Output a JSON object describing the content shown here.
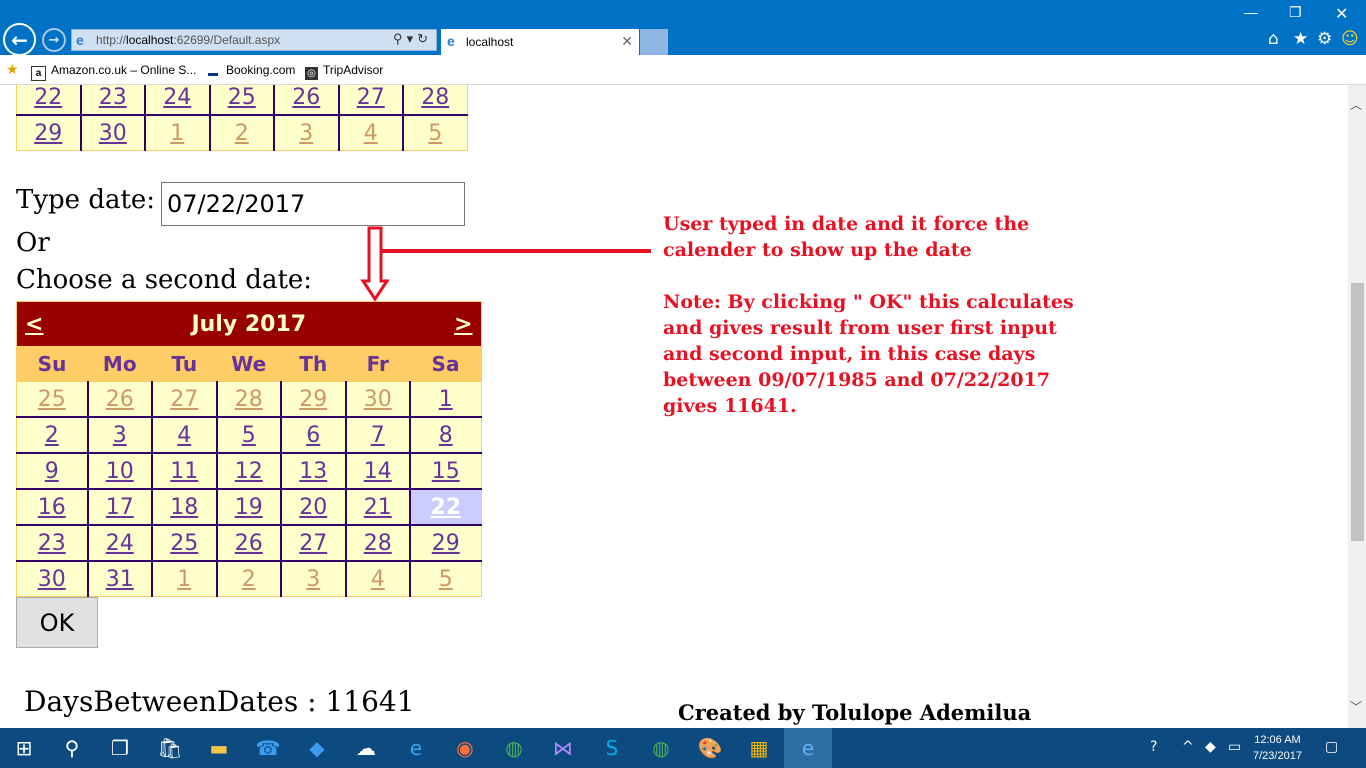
{
  "browser": {
    "url_prefix": "http://",
    "url_host": "localhost",
    "url_rest": ":62699/Default.aspx",
    "tab_title": "localhost",
    "favorites": [
      "Amazon.co.uk – Online S...",
      "Booking.com",
      "TripAdvisor"
    ]
  },
  "calendar_top": {
    "rows": [
      [
        "22",
        "23",
        "24",
        "25",
        "26",
        "27",
        "28"
      ],
      [
        "29",
        "30",
        "1",
        "2",
        "3",
        "4",
        "5"
      ]
    ]
  },
  "form": {
    "type_date_label": "Type date:",
    "date_value": "07/22/2017",
    "or_label": "Or",
    "choose_label": "Choose a second date:",
    "ok_label": "OK"
  },
  "calendar": {
    "prev": "<",
    "next": ">",
    "title": "July 2017",
    "day_headers": [
      "Su",
      "Mo",
      "Tu",
      "We",
      "Th",
      "Fr",
      "Sa"
    ],
    "weeks": [
      [
        "25",
        "26",
        "27",
        "28",
        "29",
        "30",
        "1"
      ],
      [
        "2",
        "3",
        "4",
        "5",
        "6",
        "7",
        "8"
      ],
      [
        "9",
        "10",
        "11",
        "12",
        "13",
        "14",
        "15"
      ],
      [
        "16",
        "17",
        "18",
        "19",
        "20",
        "21",
        "22"
      ],
      [
        "23",
        "24",
        "25",
        "26",
        "27",
        "28",
        "29"
      ],
      [
        "30",
        "31",
        "1",
        "2",
        "3",
        "4",
        "5"
      ]
    ],
    "selected": "22"
  },
  "result": {
    "text": "DaysBetweenDates : 11641"
  },
  "annotation": {
    "line1": "User typed in date and it force the calender to show up the date",
    "line2": "Note: By clicking \" OK\" this calculates and gives result from user  first input and second input, in this case days between 09/07/1985  and 07/22/2017 gives 11641."
  },
  "credit": "Created by Tolulope Ademilua",
  "taskbar": {
    "time": "12:06 AM",
    "date": "7/23/2017"
  },
  "colors": {
    "title_bg": "#990000",
    "header_bg": "#ffcc66",
    "cell_bg": "#ffffcc",
    "link": "#663399",
    "other_month": "#cc9966",
    "selected_bg": "#ccccff",
    "annotation": "#e81123",
    "browser_blue": "#0072c6"
  }
}
